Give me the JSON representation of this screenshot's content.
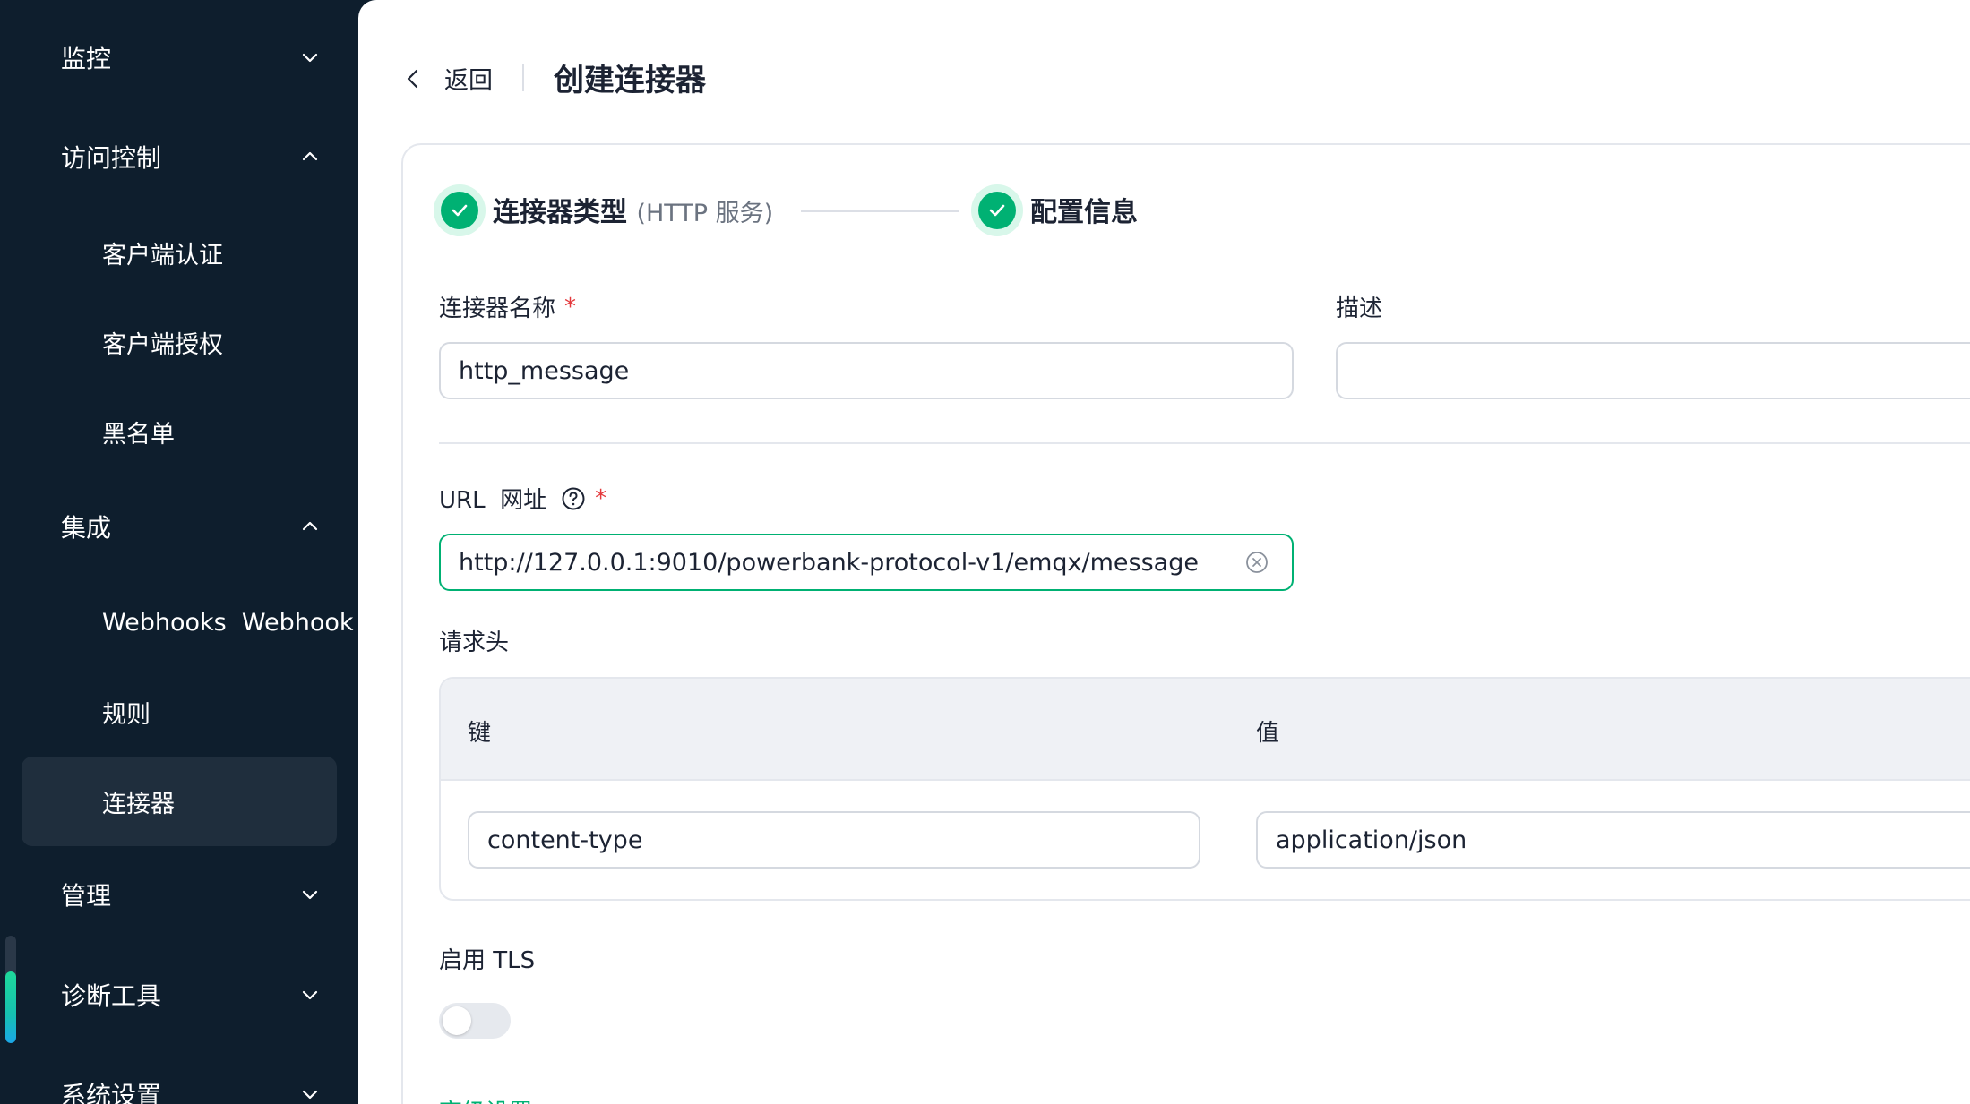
{
  "sidebar": {
    "groups": {
      "monitor": "监控",
      "access": "访问控制",
      "integration": "集成",
      "management": "管理",
      "diagnostics": "诊断工具",
      "settings": "系统设置"
    },
    "items": {
      "client_auth": "客户端认证",
      "client_authz": "客户端授权",
      "blacklist": "黑名单",
      "webhooks": "Webhooks  Webhook",
      "rules": "规则",
      "connectors": "连接器"
    }
  },
  "header": {
    "back_label": "返回",
    "title": "创建连接器"
  },
  "steps": {
    "step1_title": "连接器类型",
    "step1_sub": "(HTTP 服务)",
    "step2_title": "配置信息"
  },
  "form": {
    "name_label": "连接器名称",
    "name_value": "http_message",
    "required_mark": "*",
    "desc_label": "描述",
    "desc_value": "",
    "url_label": "URL  网址",
    "url_value": "http://127.0.0.1:9010/powerbank-protocol-v1/emqx/message",
    "headers_label": "请求头",
    "headers_key_col": "键",
    "headers_value_col": "值",
    "header_key": "content-type",
    "header_value": "application/json",
    "tls_label": "启用 TLS",
    "tls_enabled": false,
    "advanced_label": "高级设置"
  },
  "colors": {
    "sidebar_bg": "#0e1e2d",
    "accent": "#00b173",
    "required": "#e4393c"
  }
}
